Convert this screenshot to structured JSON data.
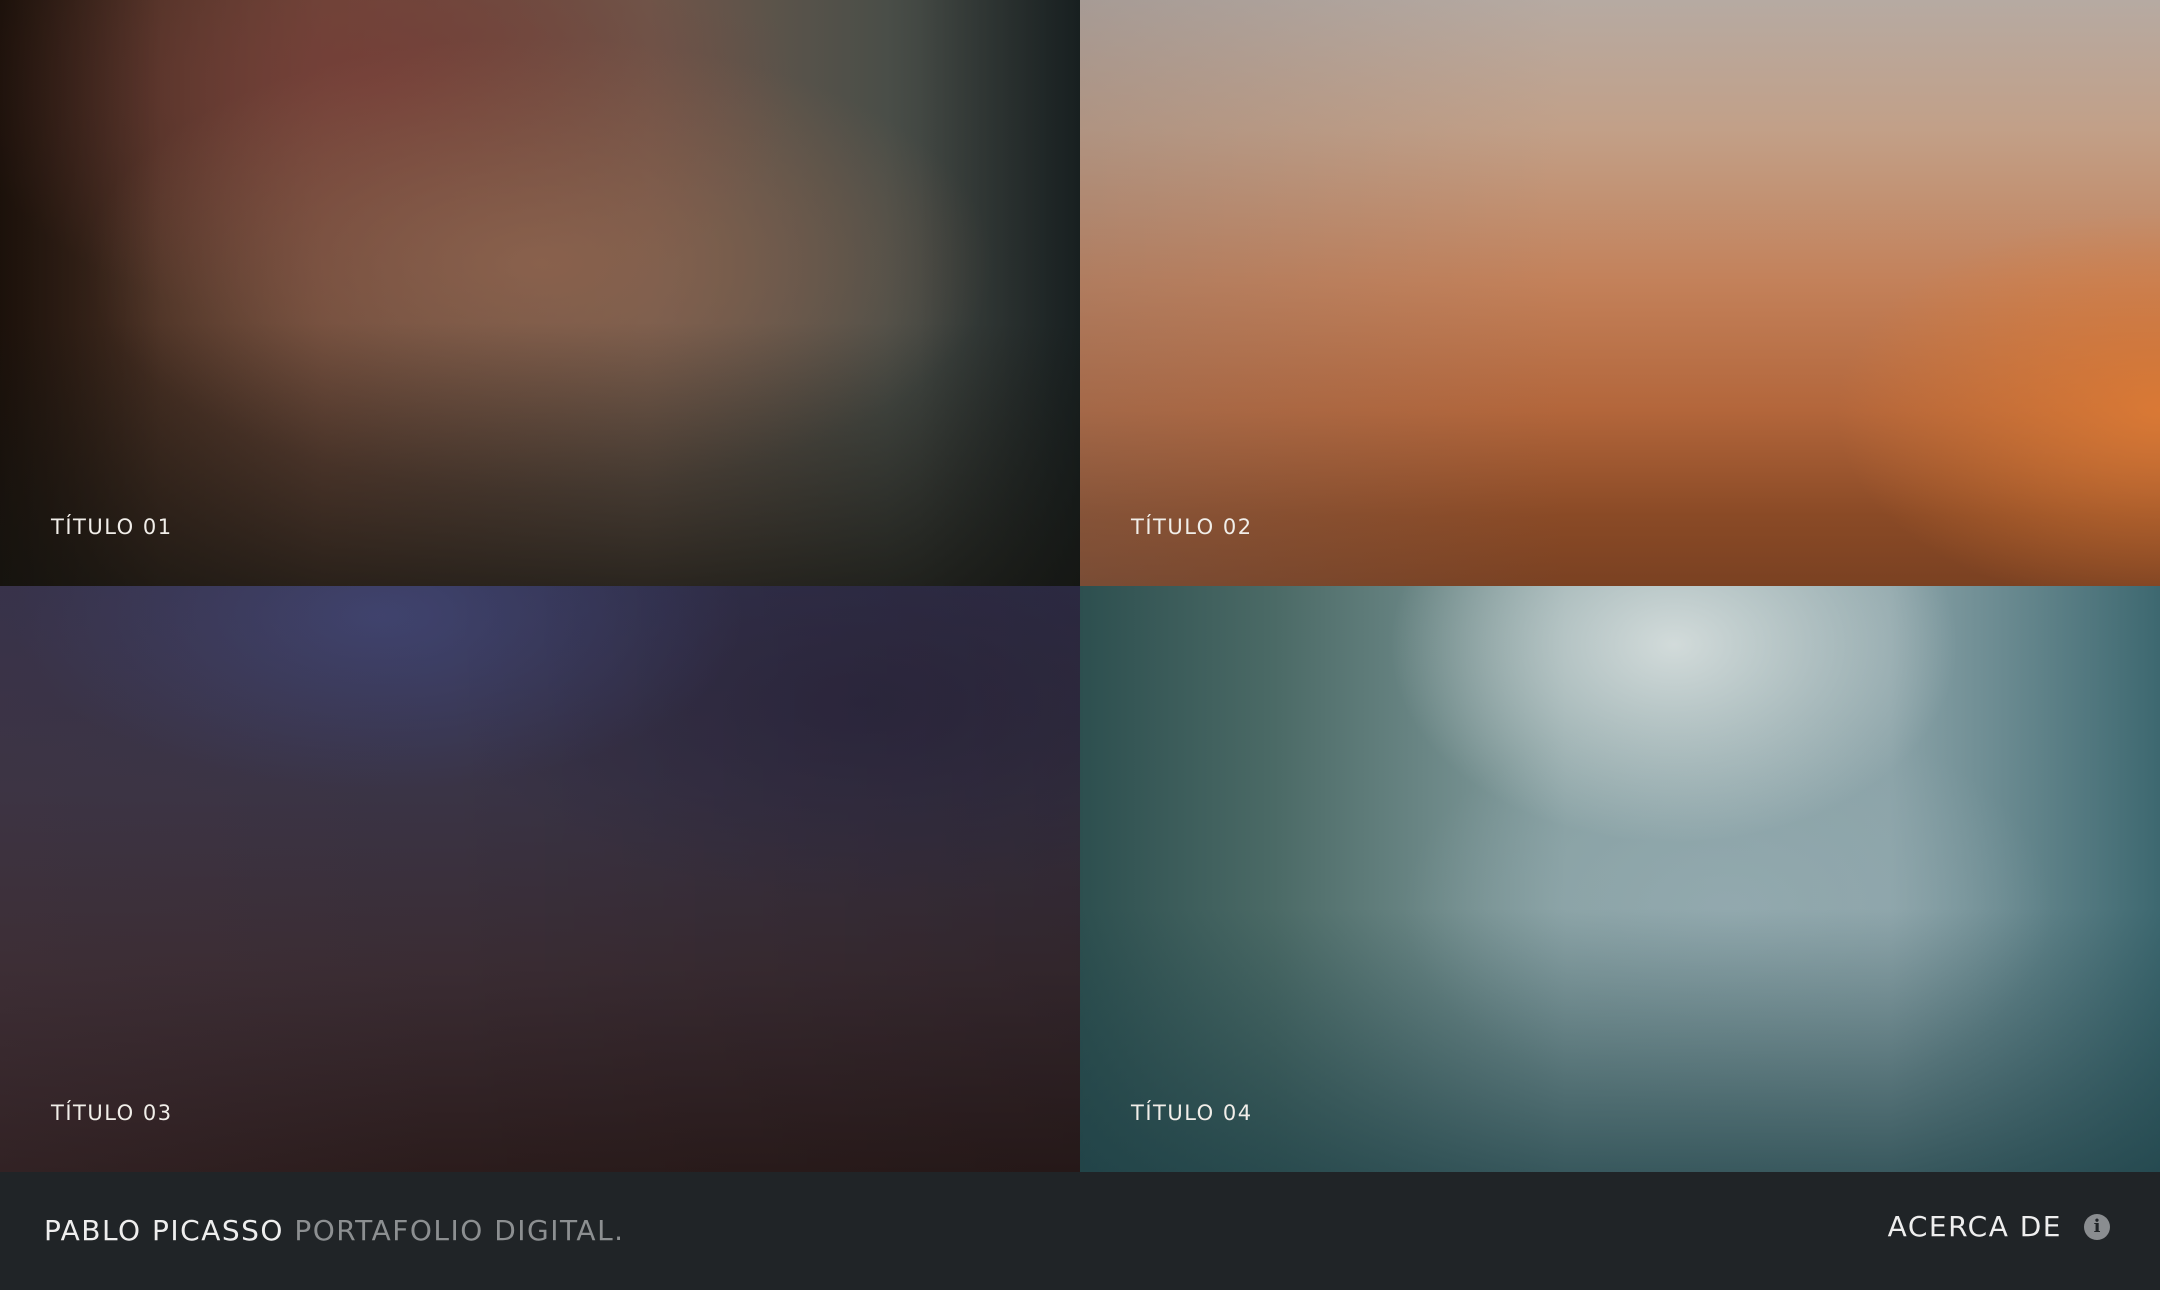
{
  "tiles": [
    {
      "label": "TÍTULO 01"
    },
    {
      "label": "TÍTULO 02"
    },
    {
      "label": "TÍTULO 03"
    },
    {
      "label": "TÍTULO 04"
    }
  ],
  "footer": {
    "brand_name": "PABLO PICASSO",
    "brand_subtitle": "PORTAFOLIO DIGITAL.",
    "about_label": "ACERCA DE",
    "about_icon": "info-icon"
  },
  "colors": {
    "footer_background": "#202427",
    "footer_text": "#eeeeee",
    "footer_muted_text": "#8c8f91"
  }
}
